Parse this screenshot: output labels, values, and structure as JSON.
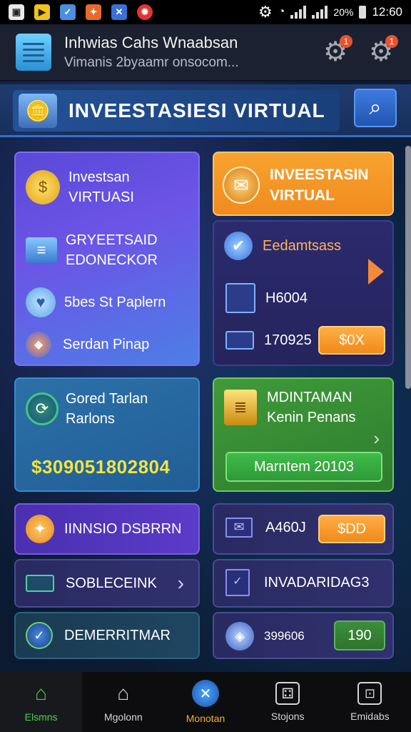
{
  "status_bar": {
    "battery_text": "20%",
    "time": "12:60"
  },
  "notification": {
    "title": "Inhwias Cahs Wnaabsan",
    "subtitle": "Vimanis 2byaamr onsocom...",
    "badge_1": "1",
    "badge_2": "1"
  },
  "banner": {
    "title": "INVEESTASIESI  VIRTUAL"
  },
  "cards": {
    "left_top": {
      "title_1": "Investsan",
      "title_2": "VIRTUASI",
      "item_1a": "GRYEETSAID",
      "item_1b": "EDONECKOR",
      "item_2": "5bes St Paplern",
      "item_3": "Serdan Pinap"
    },
    "right_orange": {
      "title_1": "INVEESTASIN",
      "title_2": "VIRTUAL"
    },
    "right_navy": {
      "label": "Eedamtsass",
      "value_1": "H6004",
      "value_2": "170925",
      "button": "$0X"
    },
    "mid_left": {
      "title_1": "Gored Tarlan",
      "title_2": "Rarlons",
      "amount": "$309051802804"
    },
    "mid_right": {
      "title_1": "MDINTAMAN",
      "title_2": "Kenin Penans",
      "button": "Marntem 20103"
    },
    "list_left": [
      {
        "label": "IINNSIO DSBRRN"
      },
      {
        "label": "SOBLECEINK"
      },
      {
        "label": "DEMERRITMAR"
      }
    ],
    "list_right": [
      {
        "label": "A460J",
        "button": "$DD"
      },
      {
        "label": "INVADARIDAG3"
      },
      {
        "label": "399606",
        "button": "190"
      }
    ]
  },
  "bottom_nav": [
    {
      "label": "Elsmns",
      "color": "#4bd04b"
    },
    {
      "label": "Mgolonn",
      "color": "#d6d6d6"
    },
    {
      "label": "Monotan",
      "color": "#f2b02a"
    },
    {
      "label": "Stojons",
      "color": "#d6d6d6"
    },
    {
      "label": "Emidabs",
      "color": "#d6d6d6"
    }
  ]
}
